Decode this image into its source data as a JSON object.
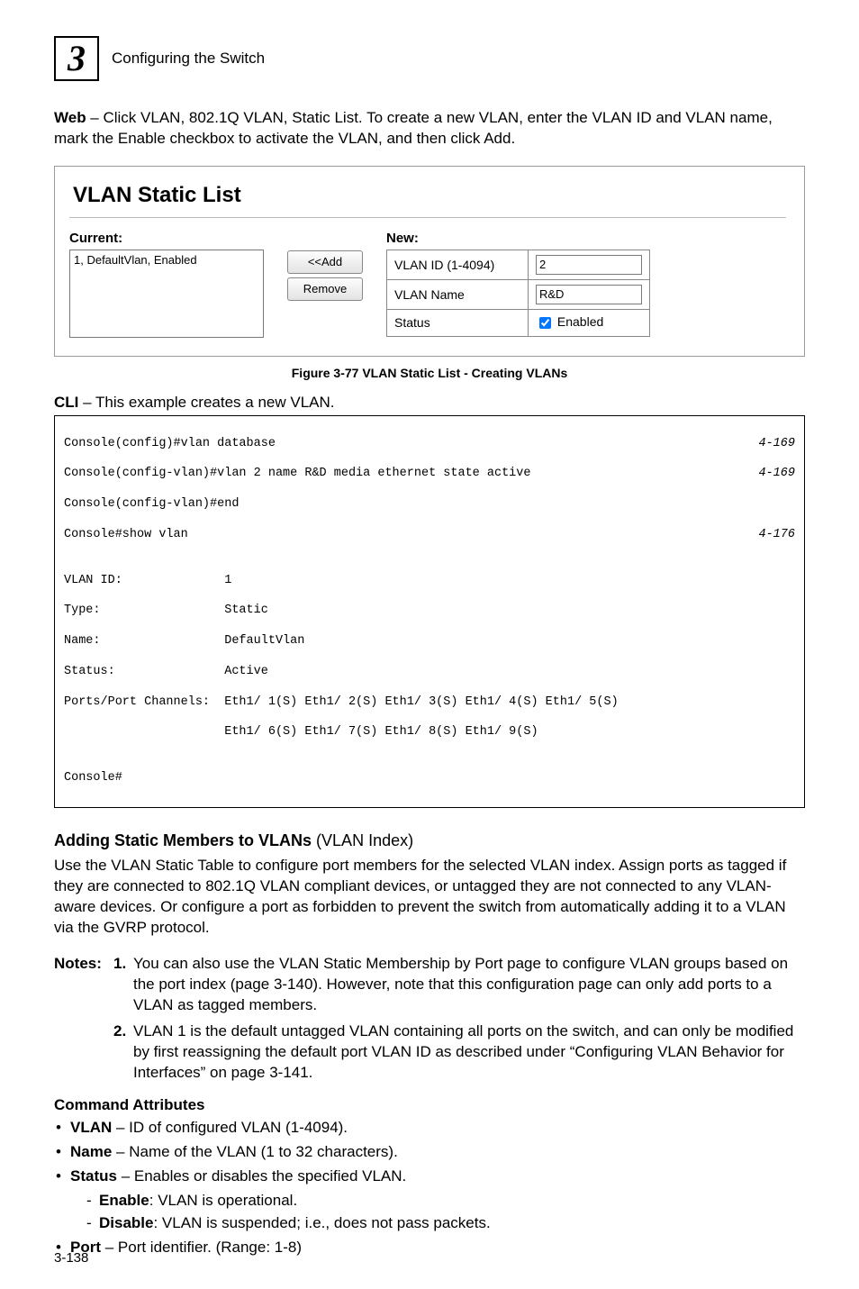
{
  "header": {
    "page_icon_text": "3",
    "chapter_title": "Configuring the Switch"
  },
  "intro": {
    "web_label": "Web",
    "web_text": " – Click VLAN, 802.1Q VLAN, Static List. To create a new VLAN, enter the VLAN ID and VLAN name, mark the Enable checkbox to activate the VLAN, and then click Add."
  },
  "shot": {
    "title": "VLAN Static List",
    "current_label": "Current:",
    "current_option": "1, DefaultVlan, Enabled",
    "add_btn": "<<Add",
    "remove_btn": "Remove",
    "new_label": "New:",
    "rows": {
      "vlan_id_label": "VLAN ID (1-4094)",
      "vlan_id_value": "2",
      "vlan_name_label": "VLAN Name",
      "vlan_name_value": "R&D",
      "status_label": "Status",
      "status_text": " Enabled"
    }
  },
  "figure_caption": "Figure 3-77   VLAN Static List - Creating VLANs",
  "cli_intro": {
    "label": "CLI",
    "text": " – This example creates a new VLAN."
  },
  "cli": {
    "line1": "Console(config)#vlan database",
    "ref1": "4-169",
    "line2": "Console(config-vlan)#vlan 2 name R&D media ethernet state active",
    "ref2": "4-169",
    "line3": "Console(config-vlan)#end",
    "line4": "Console#show vlan",
    "ref4": "4-176",
    "blank": "",
    "l5": "VLAN ID:              1",
    "l6": "Type:                 Static",
    "l7": "Name:                 DefaultVlan",
    "l8": "Status:               Active",
    "l9": "Ports/Port Channels:  Eth1/ 1(S) Eth1/ 2(S) Eth1/ 3(S) Eth1/ 4(S) Eth1/ 5(S)",
    "l10": "                      Eth1/ 6(S) Eth1/ 7(S) Eth1/ 8(S) Eth1/ 9(S)",
    "l11": "Console#"
  },
  "section2": {
    "title": "Adding Static Members to VLANs ",
    "title_paren": "(VLAN Index)",
    "para": "Use the VLAN Static Table to configure port members for the selected VLAN index. Assign ports as tagged if they are connected to 802.1Q VLAN compliant devices, or untagged they are not connected to any VLAN-aware devices. Or configure a port as forbidden to prevent the switch from automatically adding it to a VLAN via the GVRP protocol."
  },
  "notes": {
    "label": "Notes:",
    "n1": "1.",
    "n1_text": "You can also use the VLAN Static Membership by Port page to configure VLAN groups based on the port index (page 3-140). However, note that this configuration page can only add ports to a VLAN as tagged members.",
    "n2": "2.",
    "n2_text": "VLAN 1 is the default untagged VLAN containing all ports on the switch, and can only be modified by first reassigning the default port VLAN ID as described under “Configuring VLAN Behavior for Interfaces” on page 3-141."
  },
  "cmd_attr_title": "Command Attributes",
  "bullets": {
    "vlan_b": "VLAN",
    "vlan_t": " – ID of configured VLAN (1-4094).",
    "name_b": "Name",
    "name_t": " – Name of the VLAN (1 to 32 characters).",
    "status_b": "Status",
    "status_t": " – Enables or disables the specified VLAN.",
    "enable_b": "Enable",
    "enable_t": ": VLAN is operational.",
    "disable_b": "Disable",
    "disable_t": ": VLAN is suspended; i.e., does not pass packets.",
    "port_b": "Port",
    "port_t": " – Port identifier. (Range: 1-8)"
  },
  "footer": "3-138"
}
